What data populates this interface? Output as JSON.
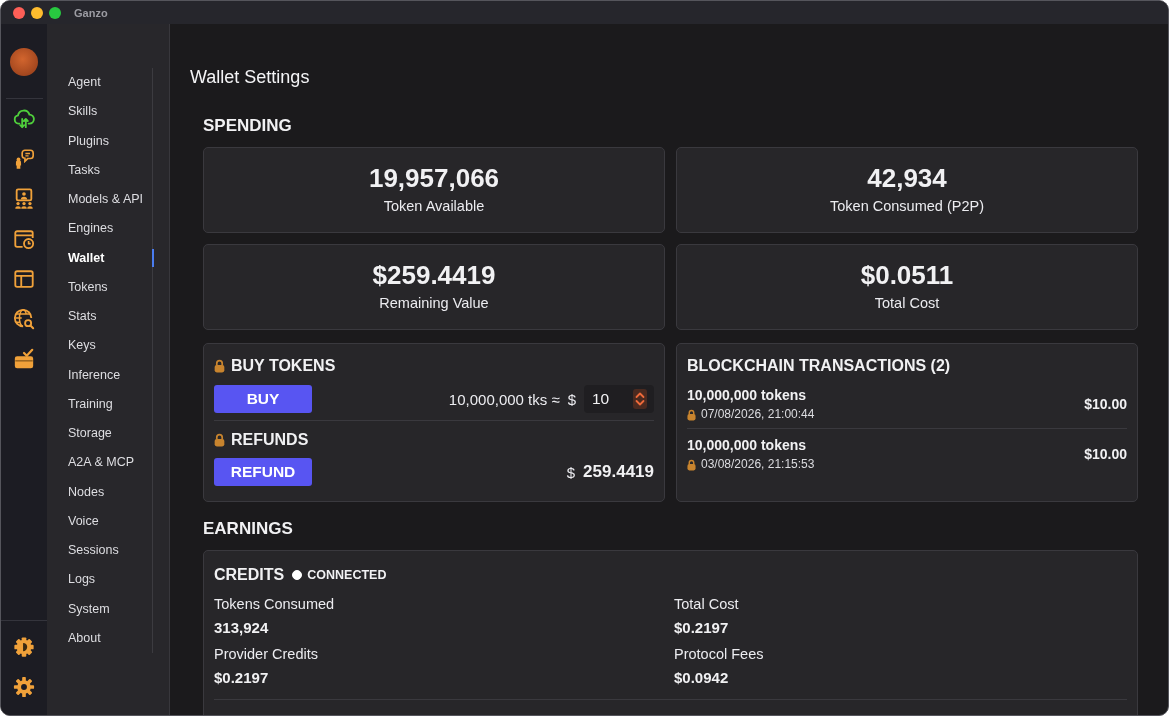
{
  "window": {
    "title": "Ganzo"
  },
  "nav": {
    "items": [
      {
        "label": "Agent",
        "selected": false
      },
      {
        "label": "Skills",
        "selected": false
      },
      {
        "label": "Plugins",
        "selected": false
      },
      {
        "label": "Tasks",
        "selected": false
      },
      {
        "label": "Models & API",
        "selected": false
      },
      {
        "label": "Engines",
        "selected": false
      },
      {
        "label": "Wallet",
        "selected": true
      },
      {
        "label": "Tokens",
        "selected": false
      },
      {
        "label": "Stats",
        "selected": false
      },
      {
        "label": "Keys",
        "selected": false
      },
      {
        "label": "Inference",
        "selected": false
      },
      {
        "label": "Training",
        "selected": false
      },
      {
        "label": "Storage",
        "selected": false
      },
      {
        "label": "A2A & MCP",
        "selected": false
      },
      {
        "label": "Nodes",
        "selected": false
      },
      {
        "label": "Voice",
        "selected": false
      },
      {
        "label": "Sessions",
        "selected": false
      },
      {
        "label": "Logs",
        "selected": false
      },
      {
        "label": "System",
        "selected": false
      },
      {
        "label": "About",
        "selected": false
      }
    ]
  },
  "page": {
    "title": "Wallet Settings"
  },
  "spending": {
    "heading": "SPENDING",
    "stats": [
      {
        "value": "19,957,066",
        "label": "Token Available"
      },
      {
        "value": "42,934",
        "label": "Token Consumed (P2P)"
      },
      {
        "value": "$259.4419",
        "label": "Remaining Value"
      },
      {
        "value": "$0.0511",
        "label": "Total Cost"
      }
    ],
    "buy_tokens": {
      "heading": "BUY TOKENS",
      "locked": true,
      "button": "BUY",
      "rate": "10,000,000 tks ≈",
      "currency": "$",
      "amount": "10"
    },
    "refunds": {
      "heading": "REFUNDS",
      "locked": true,
      "button": "REFUND",
      "currency": "$",
      "amount": "259.4419"
    },
    "transactions": {
      "heading": "BLOCKCHAIN TRANSACTIONS (2)",
      "items": [
        {
          "tokens": "10,000,000 tokens",
          "locked": true,
          "date": "07/08/2026, 21:00:44",
          "amount": "$10.00"
        },
        {
          "tokens": "10,000,000 tokens",
          "locked": true,
          "date": "03/08/2026, 21:15:53",
          "amount": "$10.00"
        }
      ]
    }
  },
  "earnings": {
    "heading": "EARNINGS",
    "credits": {
      "heading": "CREDITS",
      "connected": true,
      "status": "CONNECTED",
      "metrics": [
        {
          "label": "Tokens Consumed",
          "value": "313,924"
        },
        {
          "label": "Total Cost",
          "value": "$0.2197"
        },
        {
          "label": "Provider Credits",
          "value": "$0.2197"
        },
        {
          "label": "Protocol Fees",
          "value": "$0.0942"
        }
      ]
    }
  }
}
